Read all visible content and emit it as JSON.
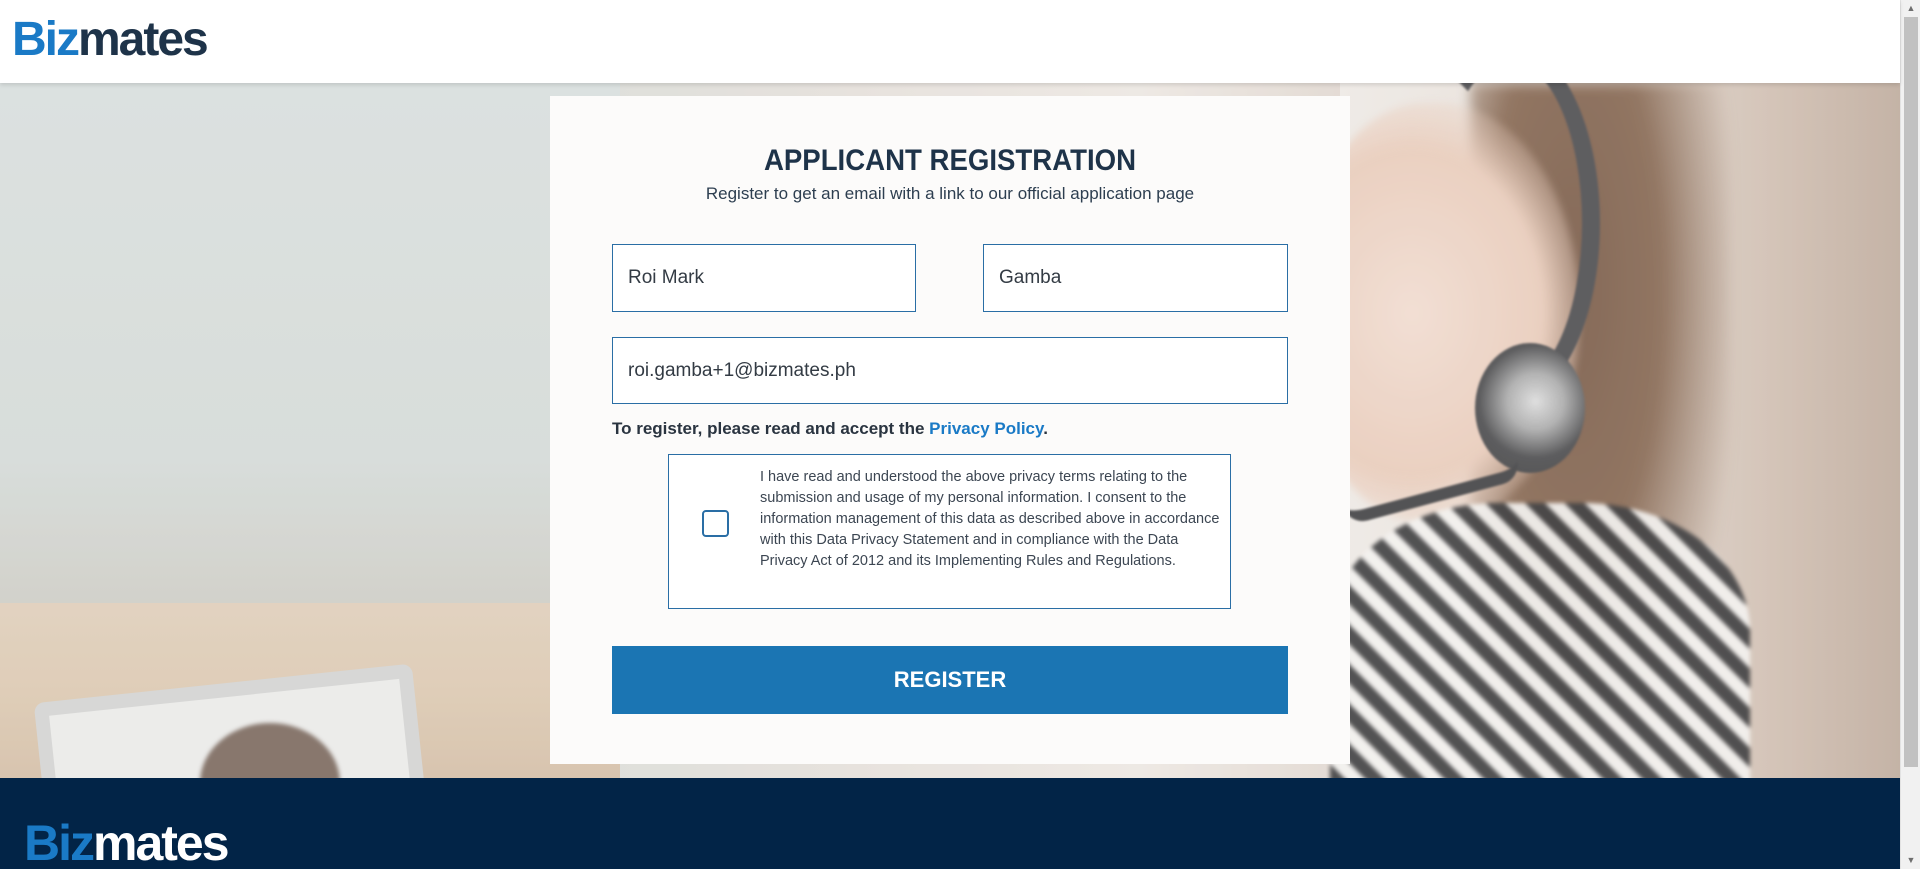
{
  "header": {
    "logo_part1": "Biz",
    "logo_part2": "mates"
  },
  "form": {
    "title": "APPLICANT REGISTRATION",
    "subtitle": "Register to get an email with a link to our official application page",
    "first_name": "Roi Mark",
    "last_name": "Gamba",
    "email": "roi.gamba+1@bizmates.ph",
    "consent_prefix": "To register, please read and accept the",
    "privacy_link": "Privacy Policy",
    "consent_suffix": ".",
    "consent_text": "I have read and understood the above privacy terms relating to the submission and usage of my personal information. I consent to the information management of this data as described above in accordance with this Data Privacy Statement and in compliance with the Data Privacy Act of 2012 and its Implementing Rules and Regulations.",
    "consent_checked": false,
    "register_label": "REGISTER"
  },
  "footer": {
    "logo_part1": "Biz",
    "logo_part2": "mates"
  },
  "colors": {
    "brand_blue": "#1a7ac6",
    "navy": "#1e3349",
    "button": "#1b75b3",
    "footer_bg": "#022447"
  },
  "icons": {
    "scroll_up": "▲",
    "scroll_down": "▼"
  }
}
